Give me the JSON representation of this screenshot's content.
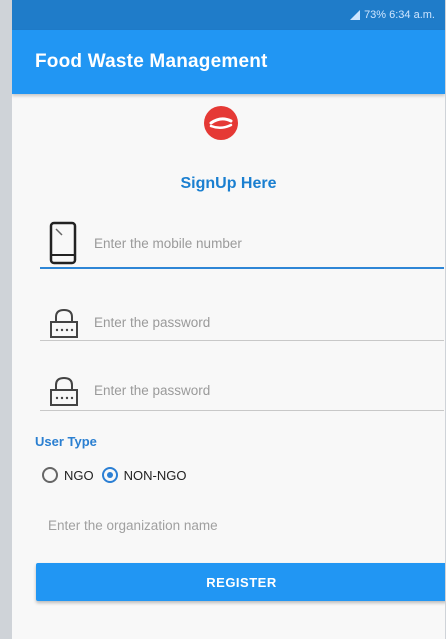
{
  "status_bar": {
    "text": "73% 6:34 a.m."
  },
  "app_bar": {
    "title": "Food Waste Management"
  },
  "signup": {
    "heading": "SignUp Here"
  },
  "fields": {
    "mobile": {
      "placeholder": "Enter the mobile number",
      "icon": "phone-icon"
    },
    "password": {
      "placeholder": "Enter the password",
      "icon": "lock-icon"
    },
    "confirm_password": {
      "placeholder": "Enter the password",
      "icon": "lock-icon"
    },
    "organization": {
      "placeholder": "Enter the organization name"
    }
  },
  "user_type": {
    "label": "User Type",
    "options": [
      {
        "label": "NGO",
        "selected": false
      },
      {
        "label": "NON-NGO",
        "selected": true
      }
    ]
  },
  "register": {
    "label": "REGISTER"
  },
  "colors": {
    "primary": "#2196f3",
    "accent": "#1a7fd0",
    "logo": "#e53935"
  }
}
